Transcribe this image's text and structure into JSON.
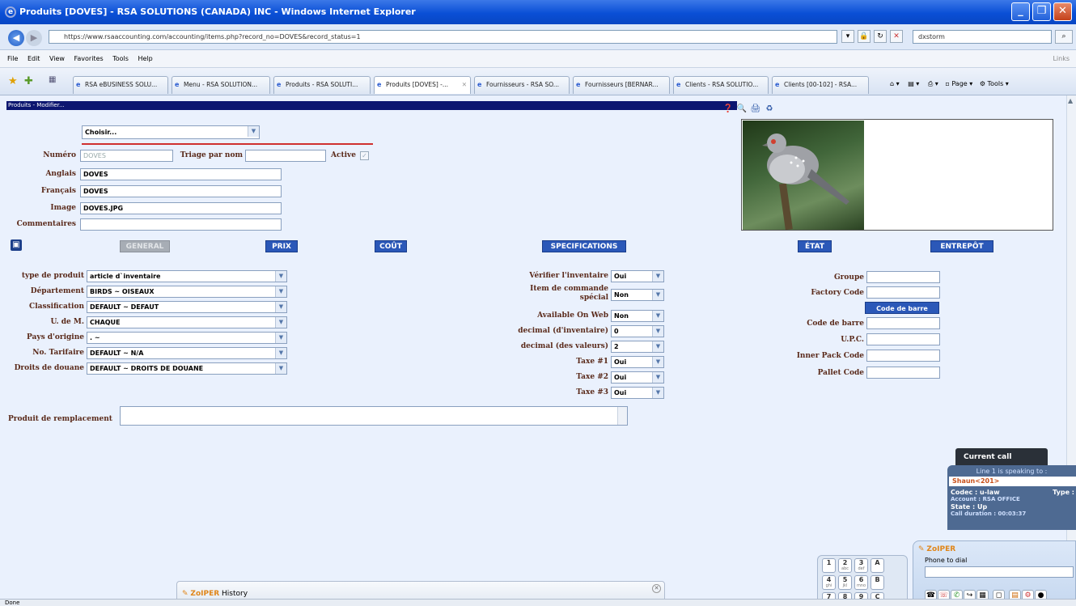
{
  "window": {
    "title": "Produits [DOVES] - RSA SOLUTIONS (CANADA) INC - Windows Internet Explorer"
  },
  "address": {
    "url": "https://www.rsaaccounting.com/accounting/items.php?record_no=DOVES&record_status=1",
    "search": "dxstorm"
  },
  "menu": {
    "items": [
      "File",
      "Edit",
      "View",
      "Favorites",
      "Tools",
      "Help"
    ],
    "links": "Links"
  },
  "tabs": [
    "RSA eBUSINESS SOLU...",
    "Menu - RSA SOLUTION...",
    "Produits - RSA SOLUTI...",
    "Produits [DOVES] -...",
    "Fournisseurs - RSA SO...",
    "Fournisseurs [BERNAR...",
    "Clients - RSA SOLUTIO...",
    "Clients [00-102] - RSA..."
  ],
  "toolbar": {
    "page": "Page",
    "tools": "Tools"
  },
  "form": {
    "header": "Produits - Modifier...",
    "choose": "Choisir...",
    "labels": {
      "numero": "Numéro",
      "triage": "Triage par nom",
      "active": "Active",
      "anglais": "Anglais",
      "francais": "Français",
      "image": "Image",
      "commentaires": "Commentaires"
    },
    "values": {
      "numero": "DOVES",
      "anglais": "DOVES",
      "francais": "DOVES",
      "image": "DOVES.JPG",
      "triage": "",
      "commentaires": ""
    }
  },
  "section_tabs": [
    "GENERAL",
    "PRIX",
    "COÛT",
    "SPECIFICATIONS",
    "ÉTAT",
    "ENTREPÔT"
  ],
  "left_fields": [
    {
      "label": "type de produit",
      "value": "article d`inventaire"
    },
    {
      "label": "Département",
      "value": "BIRDS ~ OISEAUX"
    },
    {
      "label": "Classification",
      "value": "DEFAULT ~ DEFAUT"
    },
    {
      "label": "U. de M.",
      "value": "CHAQUE"
    },
    {
      "label": "Pays d'origine",
      "value": ". ~"
    },
    {
      "label": "No. Tarifaire",
      "value": "DEFAULT ~ N/A"
    },
    {
      "label": "Droits de douane",
      "value": "DEFAULT ~ DROITS DE DOUANE"
    }
  ],
  "mid_fields": [
    {
      "label": "Vérifier l'inventaire",
      "value": "Oui"
    },
    {
      "label": "Item de commande spécial",
      "value": "Non"
    },
    {
      "label": "Available On Web",
      "value": "Non"
    },
    {
      "label": "decimal (d'inventaire)",
      "value": "0"
    },
    {
      "label": "decimal (des valeurs)",
      "value": "2"
    },
    {
      "label": "Taxe #1",
      "value": "Oui"
    },
    {
      "label": "Taxe #2",
      "value": "Oui"
    },
    {
      "label": "Taxe #3",
      "value": "Oui"
    }
  ],
  "right_fields": {
    "groupe": "Groupe",
    "factory": "Factory Code",
    "barcode_btn": "Code de barre",
    "code_barre": "Code de barre",
    "upc": "U.P.C.",
    "inner": "Inner Pack Code",
    "pallet": "Pallet Code"
  },
  "replacement": {
    "label": "Produit de remplacement"
  },
  "zoiper": {
    "current_call": "Current call",
    "line": "Line 1 is speaking to :",
    "caller": "Shaun<201>",
    "codec": "Codec : u-law",
    "type": "Type :",
    "account": "Account : RSA OFFICE",
    "state": "State : Up",
    "duration": "Call duration : 00:03:37",
    "brand": "ZoIPER",
    "phone_to_dial": "Phone to dial",
    "history": "History"
  },
  "keypad": [
    {
      "d": "1",
      "s": ""
    },
    {
      "d": "2",
      "s": "abc"
    },
    {
      "d": "3",
      "s": "def"
    },
    {
      "d": "A",
      "s": ""
    },
    {
      "d": "4",
      "s": "ghi"
    },
    {
      "d": "5",
      "s": "jkl"
    },
    {
      "d": "6",
      "s": "mno"
    },
    {
      "d": "B",
      "s": ""
    },
    {
      "d": "7",
      "s": ""
    },
    {
      "d": "8",
      "s": ""
    },
    {
      "d": "9",
      "s": ""
    },
    {
      "d": "C",
      "s": ""
    }
  ],
  "status": {
    "text": "Done"
  }
}
